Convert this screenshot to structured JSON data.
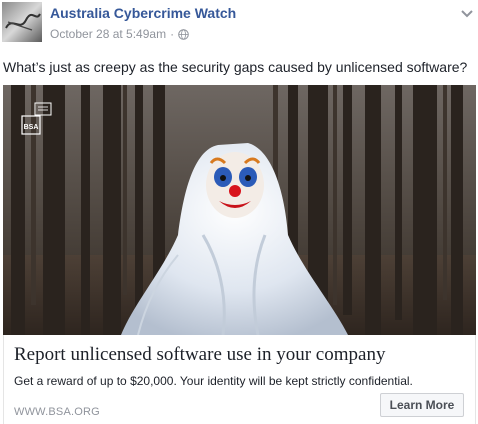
{
  "post": {
    "page_name": "Australia Cybercrime Watch",
    "timestamp": "October 28 at 5:49am",
    "separator": "·",
    "privacy_icon": "globe-icon",
    "menu_icon": "chevron-down-icon",
    "text": "What’s just as creepy as the security gaps caused by unlicensed software?"
  },
  "ad": {
    "logo_text": "BSA",
    "headline": "Report unlicensed software use in your company",
    "description": "Get a reward of up to $20,000. Your identity will be kept strictly confidential.",
    "domain": "WWW.BSA.ORG",
    "cta_label": "Learn More"
  },
  "colors": {
    "link_blue": "#365899",
    "meta_gray": "#90949c",
    "text_dark": "#1d2129"
  }
}
